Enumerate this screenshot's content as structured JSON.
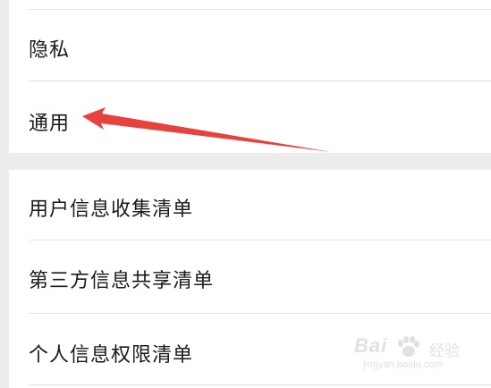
{
  "settings": {
    "group1": [
      {
        "label": "隐私"
      },
      {
        "label": "通用"
      }
    ],
    "group2": [
      {
        "label": "用户信息收集清单"
      },
      {
        "label": "第三方信息共享清单"
      },
      {
        "label": "个人信息权限清单"
      }
    ]
  },
  "annotation": {
    "arrow_color": "#e8423d"
  },
  "watermark": {
    "brand": "Bai",
    "sub": "经验",
    "url": "jingyan.baidu.com"
  }
}
